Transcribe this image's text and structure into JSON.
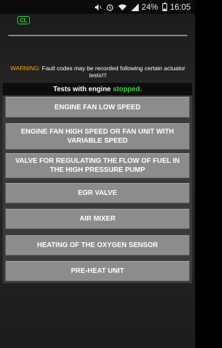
{
  "status_bar": {
    "icons": [
      "mute-icon",
      "alarm-icon",
      "wifi-icon",
      "signal-icon",
      "battery-icon"
    ],
    "battery": "24%",
    "time": "16:05"
  },
  "header": {
    "badge": "CL"
  },
  "warning": {
    "label": "WARNING:",
    "text": "Fault codes may be recorded following certain actuator tests!!!"
  },
  "panel": {
    "title_prefix": "Tests with engine",
    "title_state": "stopped."
  },
  "tests": [
    "ENGINE FAN LOW SPEED",
    "ENGINE FAN HIGH SPEED OR FAN UNIT WITH VARIABLE SPEED",
    "VALVE FOR REGULATING THE FLOW OF FUEL IN THE HIGH PRESSURE PUMP",
    "EGR VALVE",
    "AIR MIXER",
    "HEATING OF THE OXYGEN SENSOR",
    "PRE-HEAT UNIT"
  ],
  "colors": {
    "accent_green": "#33e033",
    "warning_orange": "#ffa500",
    "button_gray": "#8c8c8c"
  }
}
